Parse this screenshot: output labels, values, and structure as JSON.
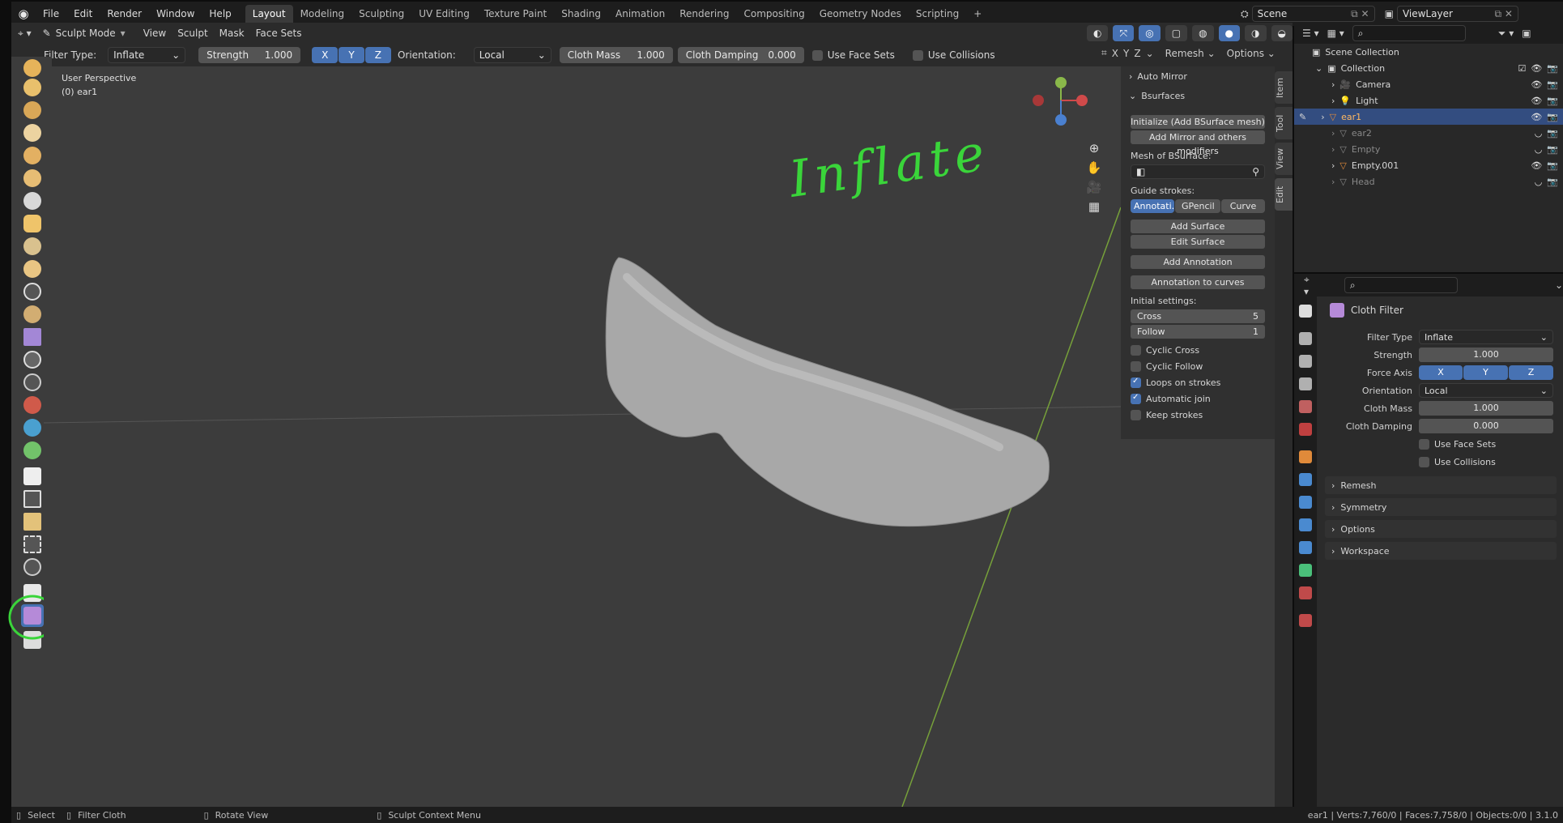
{
  "menu": {
    "items": [
      "File",
      "Edit",
      "Render",
      "Window",
      "Help"
    ]
  },
  "workspaces": [
    "Layout",
    "Modeling",
    "Sculpting",
    "UV Editing",
    "Texture Paint",
    "Shading",
    "Animation",
    "Rendering",
    "Compositing",
    "Geometry Nodes",
    "Scripting"
  ],
  "workspace_add": "+",
  "scene": {
    "name": "Scene",
    "view_layer": "ViewLayer"
  },
  "header": {
    "mode": "Sculpt Mode",
    "menus": [
      "View",
      "Sculpt",
      "Mask",
      "Face Sets"
    ]
  },
  "toolsettings": {
    "filter_type_label": "Filter Type:",
    "filter_type": "Inflate",
    "strength_label": "Strength",
    "strength": "1.000",
    "axes": [
      "X",
      "Y",
      "Z"
    ],
    "orientation_label": "Orientation:",
    "orientation": "Local",
    "cloth_mass_label": "Cloth Mass",
    "cloth_mass": "1.000",
    "cloth_damping_label": "Cloth Damping",
    "cloth_damping": "0.000",
    "use_face_sets": "Use Face Sets",
    "use_collisions": "Use Collisions",
    "mirror_axes": [
      "X",
      "Y",
      "Z"
    ],
    "remesh": "Remesh",
    "options": "Options"
  },
  "viewport": {
    "perspective": "User Perspective",
    "object": "(0) ear1",
    "annotation": "Inflate"
  },
  "npanel": {
    "tabs": [
      "Item",
      "Tool",
      "View",
      "Edit"
    ],
    "auto_mirror": "Auto Mirror",
    "bsurfaces": "Bsurfaces",
    "init_button": "Initialize (Add BSurface mesh)",
    "mirror_button": "Add Mirror and others modifiers",
    "mesh_label": "Mesh of BSurface:",
    "guide_label": "Guide strokes:",
    "guide_options": [
      "Annotati...",
      "GPencil",
      "Curve"
    ],
    "add_surface": "Add Surface",
    "edit_surface": "Edit Surface",
    "add_annotation": "Add Annotation",
    "annotation_to_curves": "Annotation to curves",
    "initial_label": "Initial settings:",
    "cross_label": "Cross",
    "cross_value": "5",
    "follow_label": "Follow",
    "follow_value": "1",
    "checks": [
      {
        "label": "Cyclic Cross",
        "on": false
      },
      {
        "label": "Cyclic Follow",
        "on": false
      },
      {
        "label": "Loops on strokes",
        "on": true
      },
      {
        "label": "Automatic join",
        "on": true
      },
      {
        "label": "Keep strokes",
        "on": false
      }
    ]
  },
  "outliner": {
    "root": "Scene Collection",
    "collection": "Collection",
    "items": [
      {
        "name": "Camera",
        "selected": false,
        "dim": false
      },
      {
        "name": "Light",
        "selected": false,
        "dim": false
      },
      {
        "name": "ear1",
        "selected": true,
        "dim": false
      },
      {
        "name": "ear2",
        "selected": false,
        "dim": true
      },
      {
        "name": "Empty",
        "selected": false,
        "dim": true
      },
      {
        "name": "Empty.001",
        "selected": false,
        "dim": false
      },
      {
        "name": "Head",
        "selected": false,
        "dim": true
      }
    ]
  },
  "properties": {
    "title": "Cloth Filter",
    "filter_type_label": "Filter Type",
    "filter_type": "Inflate",
    "strength_label": "Strength",
    "strength": "1.000",
    "force_axis_label": "Force Axis",
    "axes": [
      "X",
      "Y",
      "Z"
    ],
    "orientation_label": "Orientation",
    "orientation": "Local",
    "cloth_mass_label": "Cloth Mass",
    "cloth_mass": "1.000",
    "cloth_damping_label": "Cloth Damping",
    "cloth_damping": "0.000",
    "use_face_sets": "Use Face Sets",
    "use_collisions": "Use Collisions",
    "sections": [
      "Remesh",
      "Symmetry",
      "Options",
      "Workspace"
    ]
  },
  "status": {
    "select": "Select",
    "filter": "Filter Cloth",
    "rotate": "Rotate View",
    "context": "Sculpt Context Menu",
    "stats": "ear1 | Verts:7,760/0 | Faces:7,758/0 | Objects:0/0 | 3.1.0"
  },
  "colors": {
    "accent": "#4772b3",
    "selection": "#334d80",
    "annotation": "#3ad53a"
  }
}
